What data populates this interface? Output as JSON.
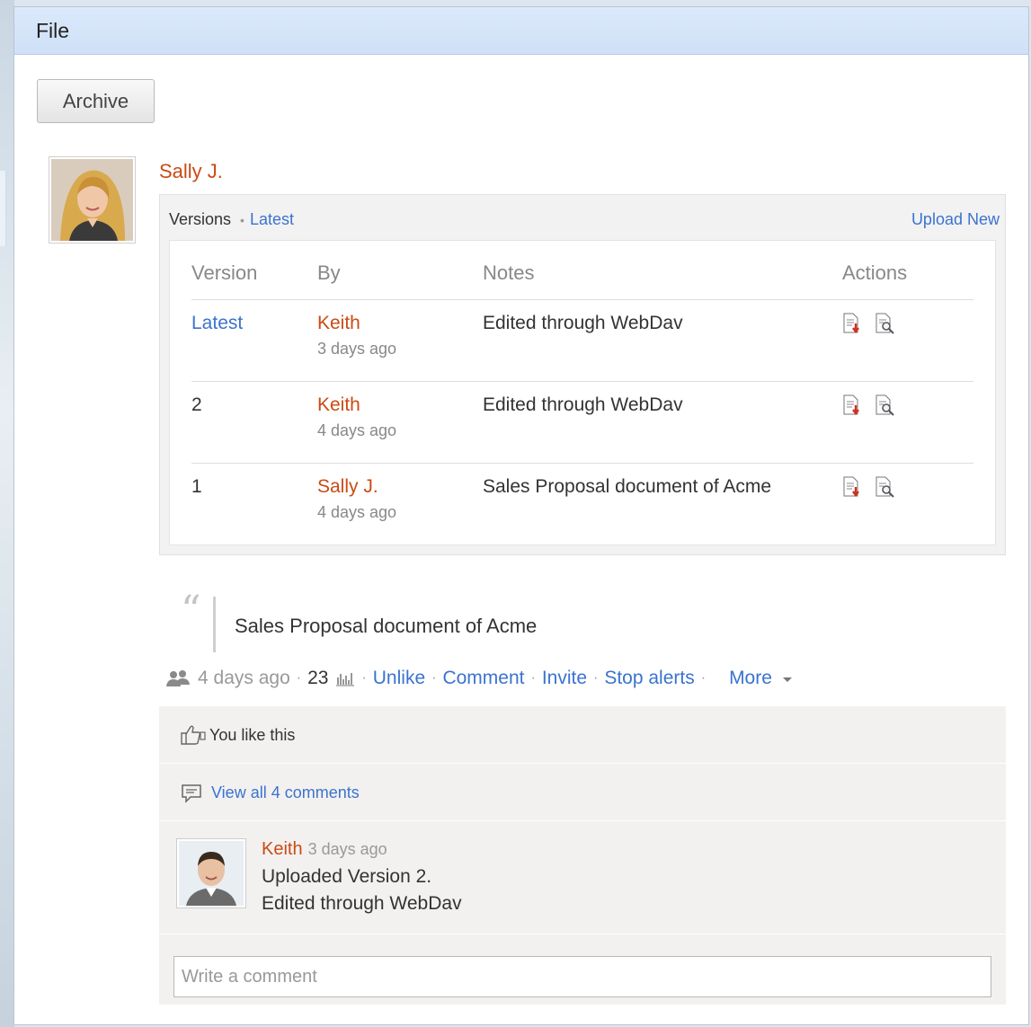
{
  "panel": {
    "title": "File"
  },
  "toolbar": {
    "archive_label": "Archive"
  },
  "post": {
    "author": "Sally J.",
    "quote": "Sales Proposal document of Acme",
    "time": "4 days ago",
    "view_count": "23"
  },
  "versions": {
    "label": "Versions",
    "latest_link": "Latest",
    "upload_new": "Upload New",
    "columns": [
      "Version",
      "By",
      "Notes",
      "Actions"
    ],
    "rows": [
      {
        "version": "Latest",
        "by": "Keith",
        "time": "3 days ago",
        "notes": "Edited through WebDav"
      },
      {
        "version": "2",
        "by": "Keith",
        "time": "4 days ago",
        "notes": "Edited through WebDav"
      },
      {
        "version": "1",
        "by": "Sally J.",
        "time": "4 days ago",
        "notes": "Sales Proposal document of Acme"
      }
    ]
  },
  "actions": {
    "unlike": "Unlike",
    "comment": "Comment",
    "invite": "Invite",
    "stop_alerts": "Stop alerts",
    "more": "More"
  },
  "feed": {
    "likes_text": "You like this",
    "view_all": "View all 4 comments",
    "comment": {
      "author": "Keith",
      "time": "3 days ago",
      "line1": "Uploaded Version 2.",
      "line2": "Edited through WebDav"
    },
    "input_placeholder": "Write a comment"
  },
  "colors": {
    "link": "#3b73cf",
    "author": "#cc4a14",
    "header": "#d6e5f9"
  }
}
